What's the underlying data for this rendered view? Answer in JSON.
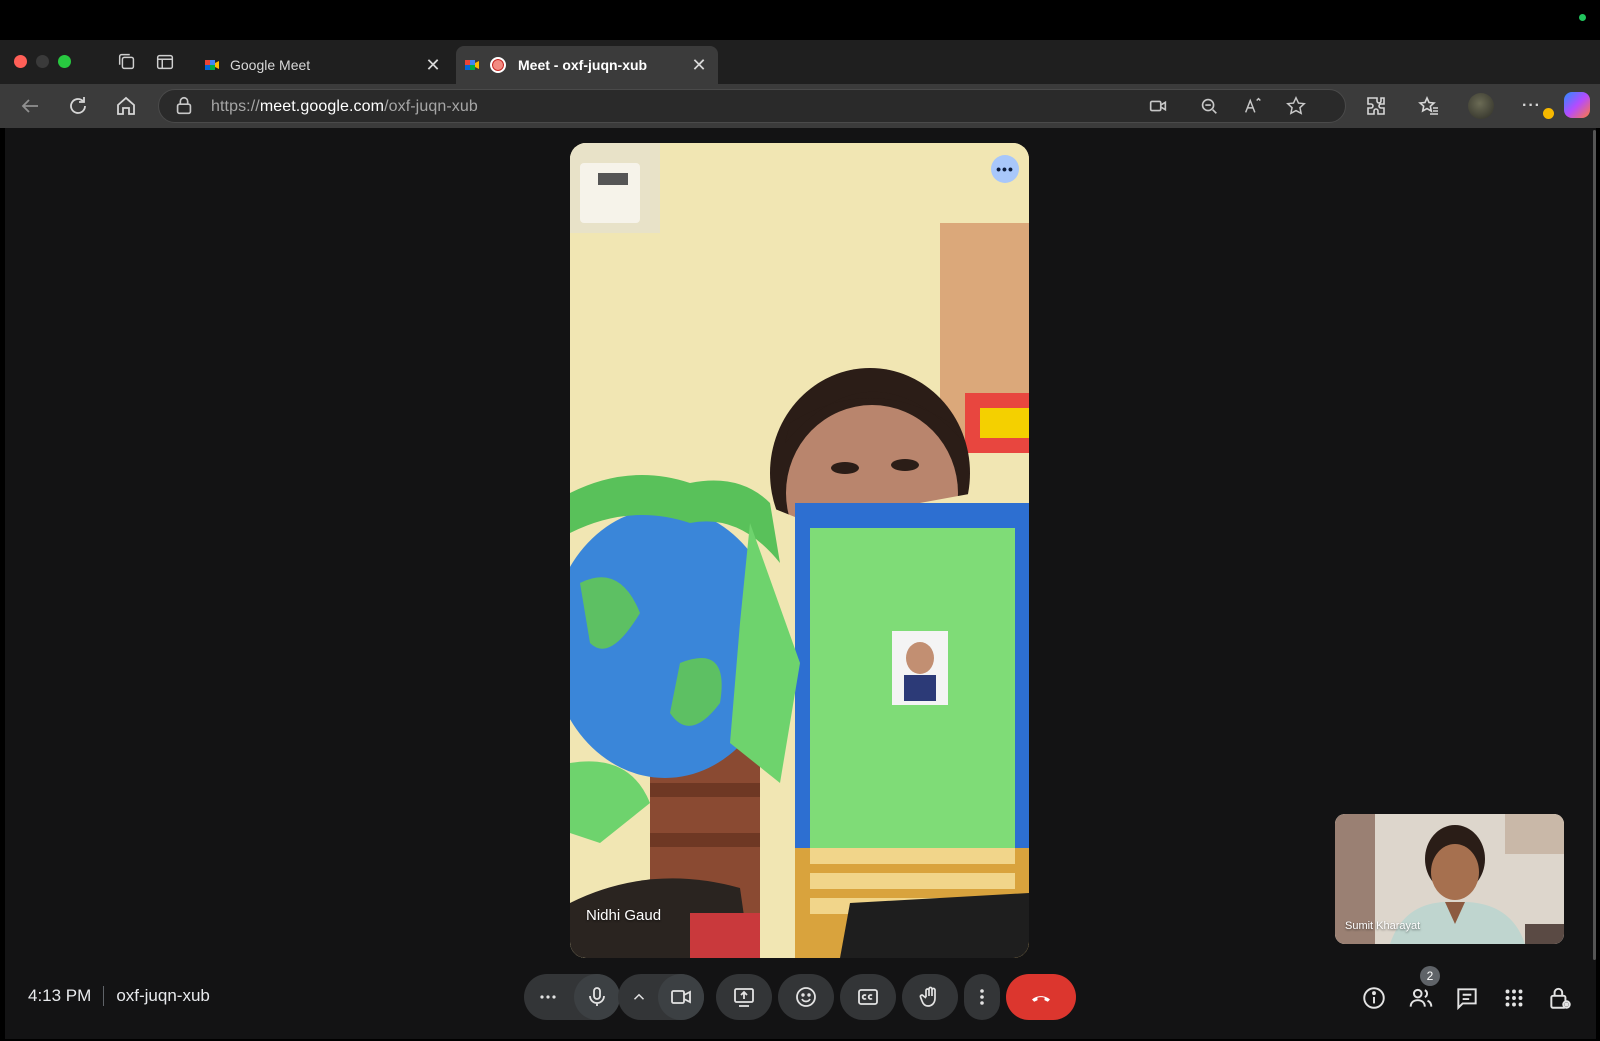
{
  "browser": {
    "tabs": [
      {
        "title": "Google Meet",
        "active": false
      },
      {
        "title": "Meet - oxf-juqn-xub",
        "active": true
      }
    ],
    "close_glyph": "✕",
    "newtab_glyph": "+",
    "url": {
      "scheme": "https://",
      "host": "meet.google.com",
      "path": "/oxf-juqn-xub"
    }
  },
  "meeting": {
    "time": "4:13 PM",
    "code": "oxf-juqn-xub",
    "main_participant": "Nidhi Gaud",
    "self_participant": "Sumit Kharayat",
    "people_count": "2",
    "more_glyph": "•••"
  },
  "colors": {
    "end_call": "#dc362e",
    "control_bg": "#333537",
    "stage_bg": "#131314",
    "more_button": "#a8c7fa"
  },
  "icons": {
    "controls": [
      "more-options-icon",
      "microphone-icon",
      "chevron-up-icon",
      "camera-icon",
      "present-screen-icon",
      "emoji-icon",
      "captions-icon",
      "raise-hand-icon",
      "more-vert-icon",
      "end-call-icon"
    ],
    "right": [
      "info-icon",
      "people-icon",
      "chat-icon",
      "activities-icon",
      "host-controls-icon"
    ]
  }
}
